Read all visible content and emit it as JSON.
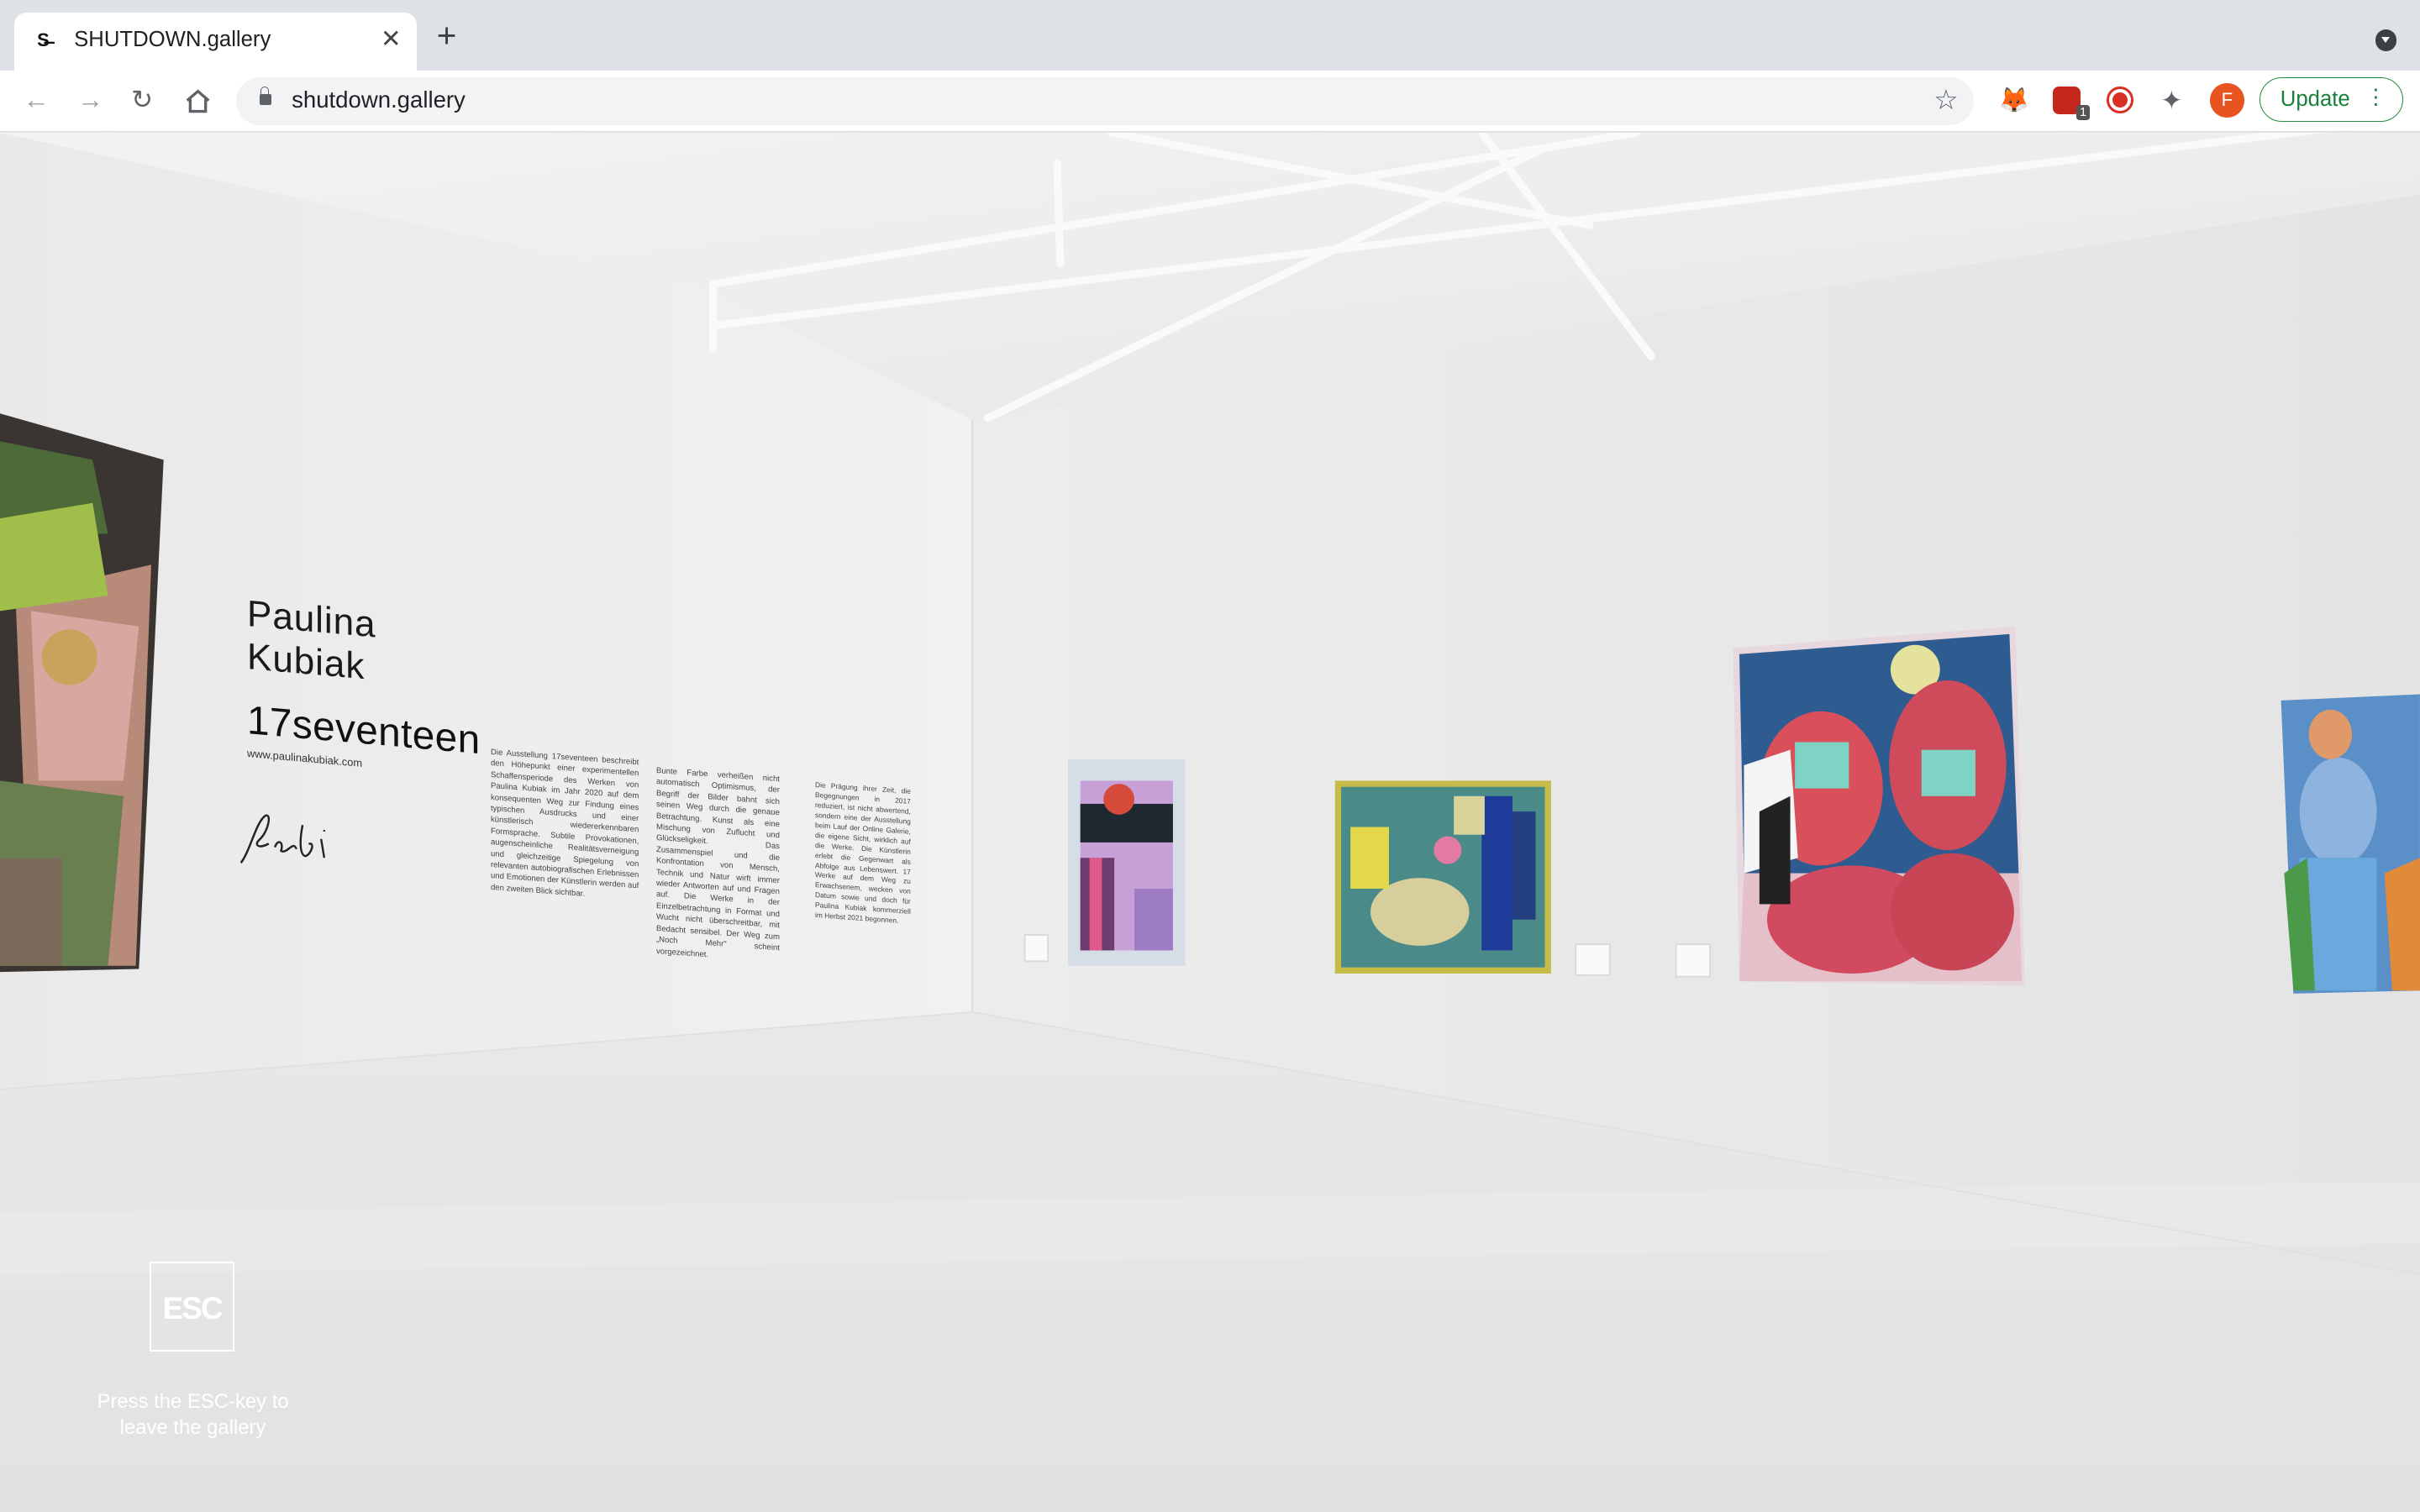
{
  "browser": {
    "tab_title": "SHUTDOWN.gallery",
    "tab_favicon": "S̶",
    "tab_close": "✕",
    "new_tab": "+",
    "url": "shutdown.gallery",
    "avatar_letter": "F",
    "update_label": "Update",
    "update_menu": "⋮",
    "abp_badge": "1"
  },
  "icons": [
    "back-arrow-icon",
    "forward-arrow-icon",
    "reload-icon",
    "home-icon",
    "lock-icon",
    "star-icon",
    "metamask-fox-icon",
    "adblock-icon",
    "record-icon",
    "puzzle-icon"
  ],
  "gallery": {
    "artist_first": "Paulina",
    "artist_last": "Kubiak",
    "exhibition_title": "17seventeen",
    "website": "www.paulinakubiak.com",
    "text_col1": "Die Ausstellung 17seventeen beschreibt den Höhepunkt einer experimentellen Schaffensperiode des Werken von Paulina Kubiak im Jahr 2020 auf dem konsequenten Weg zur Findung eines typischen Ausdrucks und einer künstlerisch wiedererkennbaren Formsprache. Subtile Provokationen, augenscheinliche Realitätsverneigung und gleichzeitige Spiegelung von relevanten autobiografischen Erlebnissen und Emotionen der Künstlerin werden auf den zweiten Blick sichtbar.",
    "text_col2": "Bunte Farbe verheißen nicht automatisch Optimismus, der Begriff der Bilder bahnt sich seinen Weg durch die genaue Betrachtung. Kunst als eine Mischung von Zuflucht und Glückseligkeit. Das Zusammenspiel und die Konfrontation von Mensch, Technik und Natur wirft immer wieder Antworten auf und Fragen auf. Die Werke in der Einzelbetrachtung in Format und Wucht nicht überschreitbar, mit Bedacht sensibel. Der Weg zum „Noch Mehr\" scheint vorgezeichnet.",
    "text_col3": "Die Prägung ihrer Zeit, die Begegnungen in 2017 reduziert, ist nicht abwertend, sondern eine der Ausstellung beim Lauf der Online Galerie, die eigene Sicht, wirklich auf die Werke. Die Künstlerin erlebt die Gegenwart als Abfolge aus Lebenswert. 17 Werke auf dem Weg zu Erwachsenem, wecken von Datum sowie und doch für Paulina Kubiak kommerziell im Herbst 2021 begonnen.",
    "esc_key": "ESC",
    "esc_hint": "Press the ESC-key to leave the gallery"
  }
}
